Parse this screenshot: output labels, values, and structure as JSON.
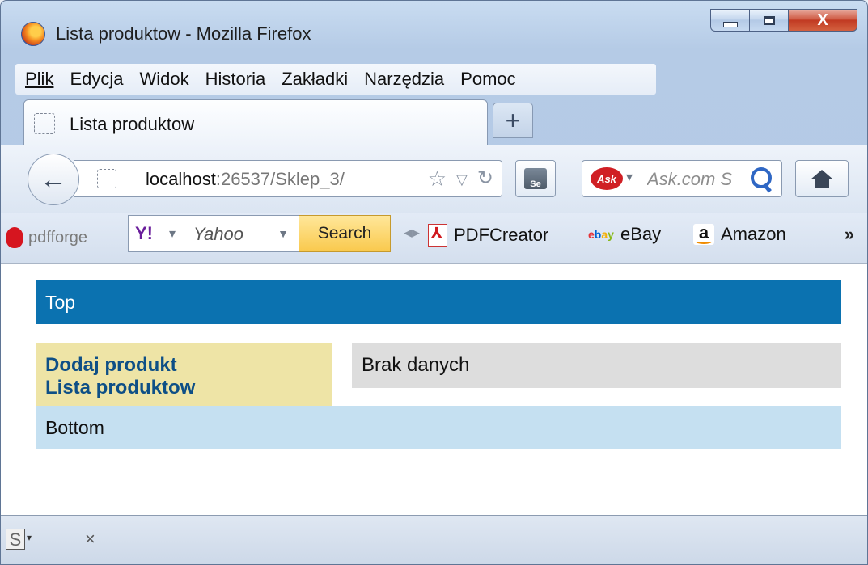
{
  "window": {
    "title": "Lista produktow - Mozilla Firefox",
    "minimize_glyph": "",
    "close_glyph": "X"
  },
  "menu": {
    "items": [
      {
        "label": "Plik",
        "accesskey": "P"
      },
      {
        "label": "Edycja",
        "accesskey": "E"
      },
      {
        "label": "Widok",
        "accesskey": "W"
      },
      {
        "label": "Historia",
        "accesskey": "H"
      },
      {
        "label": "Zakładki",
        "accesskey": "Z"
      },
      {
        "label": "Narzędzia",
        "accesskey": "N"
      },
      {
        "label": "Pomoc",
        "accesskey": "c"
      }
    ]
  },
  "tabs": {
    "active_label": "Lista produktow",
    "new_tab_label": "+"
  },
  "navbar": {
    "url_host": "localhost",
    "url_rest": ":26537/Sklep_3/",
    "search_placeholder": "Ask.com S",
    "ask_logo": "Ask"
  },
  "bookmarks": {
    "pdfforge": "pdfforge",
    "yahoo_logo": "Y!",
    "yahoo_engine": "Yahoo",
    "yahoo_search_button": "Search",
    "items": [
      "PDFCreator",
      "eBay",
      "Amazon"
    ],
    "overflow": "»"
  },
  "page": {
    "top": "Top",
    "nav_links": [
      "Dodaj produkt",
      "Lista produktow"
    ],
    "main_text": "Brak danych",
    "bottom": "Bottom"
  },
  "addonbar": {
    "s_icon": "S",
    "close": "×"
  },
  "colors": {
    "top_bar": "#0b72b0",
    "left_col": "#eee4a6",
    "main_col": "#dddddd",
    "bottom_bar": "#c5e0f1",
    "link": "#0e4f86"
  }
}
